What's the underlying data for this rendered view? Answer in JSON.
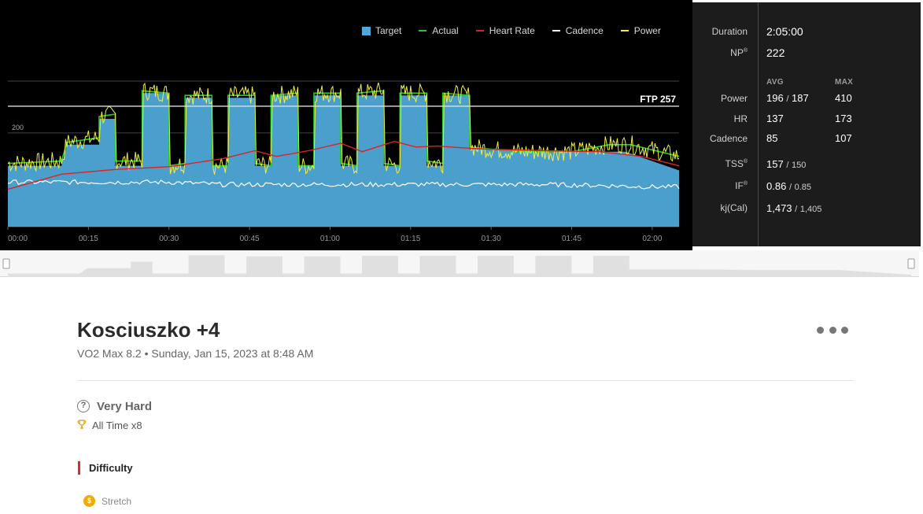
{
  "chart": {
    "legend": [
      {
        "label": "Target",
        "color": "#4fa8d8",
        "kind": "box"
      },
      {
        "label": "Actual",
        "color": "#22cc22",
        "kind": "line"
      },
      {
        "label": "Heart Rate",
        "color": "#dd2222",
        "kind": "line"
      },
      {
        "label": "Cadence",
        "color": "#ffffff",
        "kind": "line"
      },
      {
        "label": "Power",
        "color": "#eeee44",
        "kind": "line"
      }
    ],
    "ftp_label": "FTP 257",
    "y_tick_label": "200",
    "x_tick_labels": [
      "00:00",
      "00:15",
      "00:30",
      "00:45",
      "01:00",
      "01:15",
      "01:30",
      "01:45",
      "02:00"
    ]
  },
  "chart_data": {
    "type": "area",
    "x_unit": "minutes",
    "x_range": [
      0,
      125
    ],
    "y_range": [
      0,
      450
    ],
    "ftp": 257,
    "target": [
      [
        0,
        130
      ],
      [
        10,
        130
      ],
      [
        11,
        175
      ],
      [
        17,
        175
      ],
      [
        17,
        230
      ],
      [
        20,
        230
      ],
      [
        20,
        130
      ],
      [
        25,
        130
      ],
      [
        25,
        285
      ],
      [
        30,
        285
      ],
      [
        30,
        130
      ],
      [
        33,
        130
      ],
      [
        33,
        275
      ],
      [
        38,
        275
      ],
      [
        38,
        130
      ],
      [
        41,
        130
      ],
      [
        41,
        275
      ],
      [
        46,
        275
      ],
      [
        46,
        130
      ],
      [
        49,
        130
      ],
      [
        49,
        280
      ],
      [
        54,
        280
      ],
      [
        54,
        130
      ],
      [
        57,
        130
      ],
      [
        57,
        280
      ],
      [
        62,
        280
      ],
      [
        62,
        130
      ],
      [
        65,
        130
      ],
      [
        65,
        280
      ],
      [
        70,
        280
      ],
      [
        70,
        130
      ],
      [
        73,
        130
      ],
      [
        73,
        280
      ],
      [
        78,
        280
      ],
      [
        78,
        130
      ],
      [
        81,
        130
      ],
      [
        81,
        280
      ],
      [
        86,
        280
      ],
      [
        86,
        165
      ],
      [
        95,
        165
      ],
      [
        105,
        160
      ],
      [
        115,
        160
      ],
      [
        125,
        120
      ]
    ],
    "power_avg": [
      [
        0,
        135
      ],
      [
        10,
        140
      ],
      [
        11,
        180
      ],
      [
        17,
        190
      ],
      [
        17,
        235
      ],
      [
        20,
        240
      ],
      [
        20,
        140
      ],
      [
        25,
        140
      ],
      [
        25,
        290
      ],
      [
        30,
        285
      ],
      [
        30,
        130
      ],
      [
        33,
        135
      ],
      [
        33,
        280
      ],
      [
        38,
        280
      ],
      [
        38,
        130
      ],
      [
        41,
        130
      ],
      [
        41,
        280
      ],
      [
        46,
        280
      ],
      [
        46,
        135
      ],
      [
        49,
        130
      ],
      [
        49,
        280
      ],
      [
        54,
        285
      ],
      [
        54,
        130
      ],
      [
        57,
        130
      ],
      [
        57,
        285
      ],
      [
        62,
        285
      ],
      [
        62,
        135
      ],
      [
        65,
        130
      ],
      [
        65,
        285
      ],
      [
        70,
        290
      ],
      [
        70,
        135
      ],
      [
        73,
        130
      ],
      [
        73,
        285
      ],
      [
        78,
        285
      ],
      [
        78,
        140
      ],
      [
        81,
        135
      ],
      [
        81,
        285
      ],
      [
        86,
        280
      ],
      [
        86,
        170
      ],
      [
        95,
        160
      ],
      [
        105,
        160
      ],
      [
        112,
        175
      ],
      [
        116,
        175
      ],
      [
        125,
        150
      ]
    ],
    "heart_rate": [
      [
        0,
        80
      ],
      [
        10,
        112
      ],
      [
        20,
        122
      ],
      [
        30,
        128
      ],
      [
        40,
        145
      ],
      [
        46,
        162
      ],
      [
        50,
        150
      ],
      [
        56,
        162
      ],
      [
        62,
        178
      ],
      [
        66,
        160
      ],
      [
        72,
        182
      ],
      [
        76,
        170
      ],
      [
        80,
        172
      ],
      [
        85,
        168
      ],
      [
        90,
        165
      ],
      [
        100,
        162
      ],
      [
        110,
        160
      ],
      [
        118,
        150
      ],
      [
        125,
        130
      ]
    ],
    "cadence": [
      [
        0,
        95
      ],
      [
        10,
        95
      ],
      [
        20,
        95
      ],
      [
        30,
        95
      ],
      [
        40,
        90
      ],
      [
        50,
        90
      ],
      [
        60,
        90
      ],
      [
        70,
        90
      ],
      [
        80,
        90
      ],
      [
        90,
        90
      ],
      [
        100,
        90
      ],
      [
        110,
        88
      ],
      [
        120,
        85
      ],
      [
        125,
        85
      ]
    ],
    "x_ticks": [
      0,
      15,
      30,
      45,
      60,
      75,
      90,
      105,
      120
    ],
    "y_tick": 200
  },
  "stats": {
    "duration_label": "Duration",
    "duration_value": "2:05:00",
    "np_label": "NP",
    "np_value": "222",
    "avg_header": "AVG",
    "max_header": "MAX",
    "power_label": "Power",
    "power_avg": "196",
    "power_avg_target": "187",
    "power_max": "410",
    "hr_label": "HR",
    "hr_avg": "137",
    "hr_max": "173",
    "cadence_label": "Cadence",
    "cadence_avg": "85",
    "cadence_max": "107",
    "tss_label": "TSS",
    "tss_value": "157",
    "tss_target": "150",
    "if_label": "IF",
    "if_value": "0.86",
    "if_target": "0.85",
    "kj_label": "kj(Cal)",
    "kj_value": "1,473",
    "kj_target": "1,405",
    "separator": "/",
    "registered_mark": "®"
  },
  "workout": {
    "title": "Kosciuszko +4",
    "subtitle": "VO2 Max 8.2 • Sunday, Jan 15, 2023 at 8:48 AM",
    "rating_icon": "?",
    "rating": "Very Hard",
    "all_time": "All Time x8",
    "section_heading": "Difficulty",
    "level_icon": "$",
    "level": "Stretch"
  },
  "colors": {
    "target_fill": "#4fa8d8",
    "actual": "#22cc22",
    "heart_rate": "#dd2222",
    "cadence": "#ffffff",
    "power": "#eeee44",
    "accent_red": "#d32f2f",
    "badge_gold": "#f2a900"
  }
}
